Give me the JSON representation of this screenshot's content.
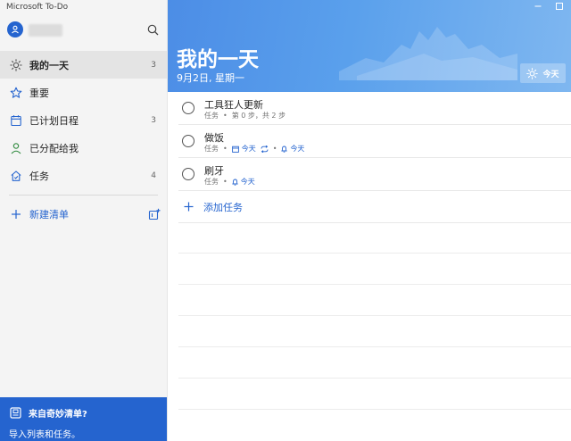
{
  "app": {
    "title": "Microsoft To-Do"
  },
  "colors": {
    "accent": "#2564cf",
    "banner": "#5aa0ec"
  },
  "sidebar": {
    "items": [
      {
        "label": "我的一天",
        "count": "3",
        "icon": "sun-icon"
      },
      {
        "label": "重要",
        "count": "",
        "icon": "star-icon"
      },
      {
        "label": "已计划日程",
        "count": "3",
        "icon": "calendar-icon"
      },
      {
        "label": "已分配给我",
        "count": "",
        "icon": "person-icon"
      },
      {
        "label": "任务",
        "count": "4",
        "icon": "home-icon"
      }
    ],
    "new_list_label": "新建清单"
  },
  "promo": {
    "title": "来自奇妙清单?",
    "subtitle": "导入列表和任务。"
  },
  "header": {
    "title": "我的一天",
    "date": "9月2日, 星期一",
    "today_button": "今天"
  },
  "tasks": [
    {
      "title": "工具狂人更新",
      "list": "任务",
      "progress": "第 0 步，共 2 步"
    },
    {
      "title": "做饭",
      "list": "任务",
      "due": "今天",
      "reminder": "今天"
    },
    {
      "title": "刷牙",
      "list": "任务",
      "reminder": "今天"
    }
  ],
  "add_task_label": "添加任务"
}
